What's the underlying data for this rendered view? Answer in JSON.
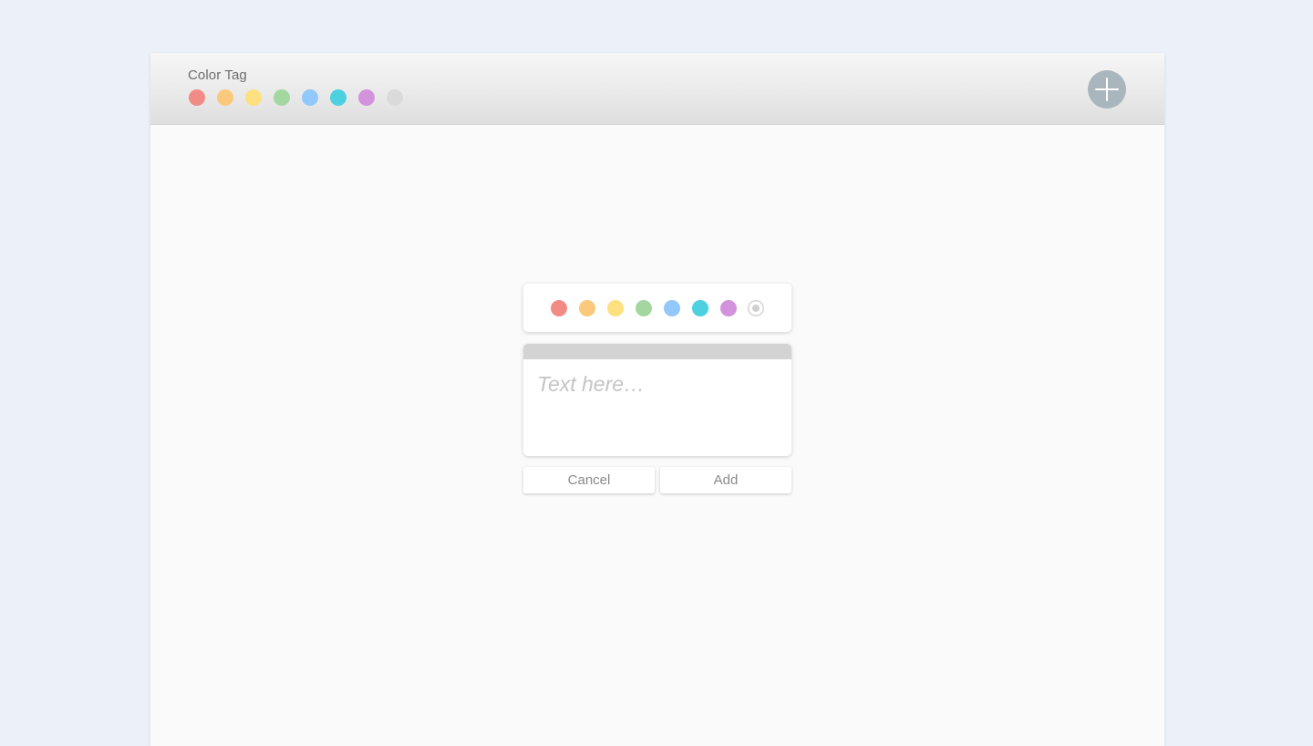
{
  "header": {
    "title": "Color Tag",
    "add_button_icon": "plus-icon"
  },
  "colors": [
    {
      "name": "red",
      "hex": "#f28b85"
    },
    {
      "name": "orange",
      "hex": "#fbc97c"
    },
    {
      "name": "yellow",
      "hex": "#fde07f"
    },
    {
      "name": "green",
      "hex": "#a4d7a0"
    },
    {
      "name": "blue",
      "hex": "#92c8fa"
    },
    {
      "name": "teal",
      "hex": "#4dd1e0"
    },
    {
      "name": "purple",
      "hex": "#d293dc"
    },
    {
      "name": "gray",
      "hex": "#dadada"
    }
  ],
  "dialog": {
    "selected_color": "gray",
    "note_placeholder": "Text here…",
    "note_value": "",
    "cancel_label": "Cancel",
    "add_label": "Add"
  }
}
